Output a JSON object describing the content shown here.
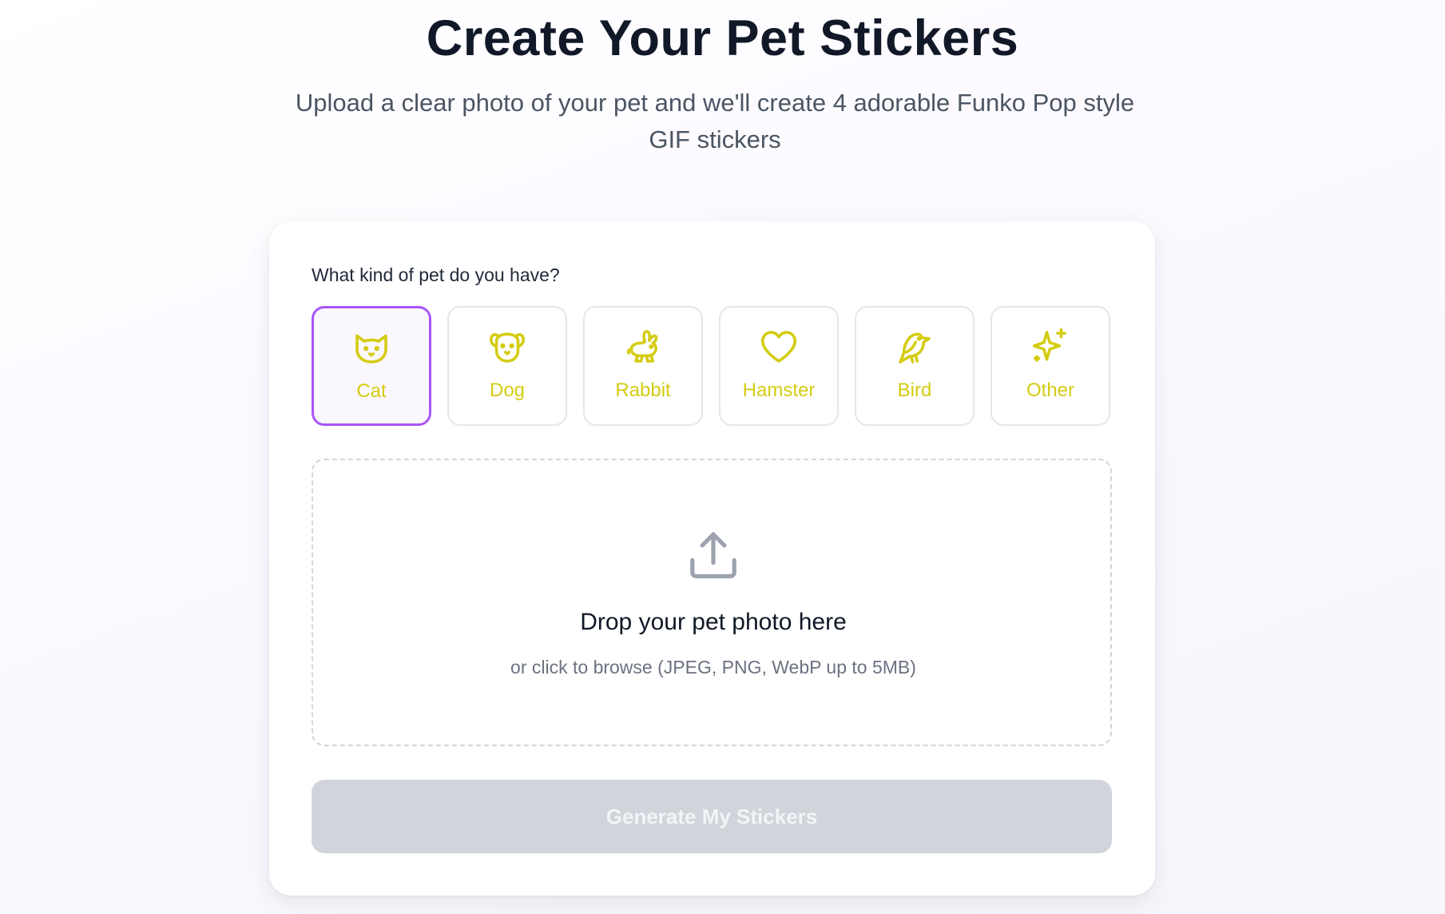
{
  "header": {
    "title": "Create Your Pet Stickers",
    "subtitle": "Upload a clear photo of your pet and we'll create 4 adorable Funko Pop style GIF stickers"
  },
  "form": {
    "question": "What kind of pet do you have?",
    "selected_pet": "Cat",
    "pets": [
      {
        "label": "Cat",
        "icon": "cat-icon",
        "selected": true
      },
      {
        "label": "Dog",
        "icon": "dog-icon",
        "selected": false
      },
      {
        "label": "Rabbit",
        "icon": "rabbit-icon",
        "selected": false
      },
      {
        "label": "Hamster",
        "icon": "heart-icon",
        "selected": false
      },
      {
        "label": "Bird",
        "icon": "bird-icon",
        "selected": false
      },
      {
        "label": "Other",
        "icon": "sparkles-icon",
        "selected": false
      }
    ],
    "dropzone": {
      "icon": "upload-icon",
      "title": "Drop your pet photo here",
      "hint": "or click to browse (JPEG, PNG, WebP up to 5MB)"
    },
    "generate_label": "Generate My Stickers",
    "generate_enabled": false
  },
  "colors": {
    "accent_selected_border": "#a855f7",
    "pet_icon_color": "#d4cc12",
    "button_disabled_bg": "#d1d5db",
    "upload_icon_color": "#9ca3af"
  }
}
